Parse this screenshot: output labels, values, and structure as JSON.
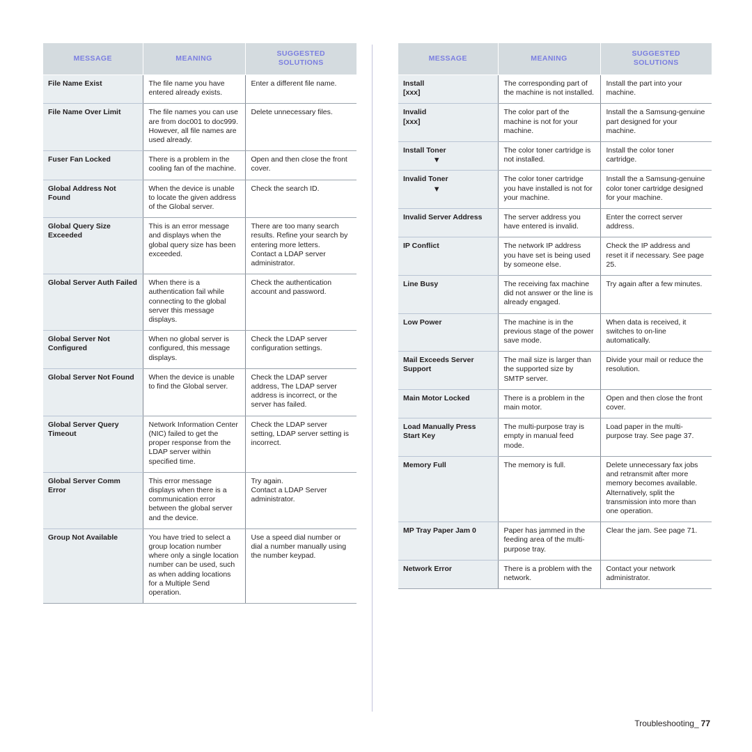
{
  "document": {
    "type": "printer-manual-troubleshooting-page",
    "footer": {
      "section_label": "Troubleshooting_",
      "page_number": "77"
    },
    "colors": {
      "header_background": "#d4dbdf",
      "header_text": "#7b7fe0",
      "message_cell_background": "#e9eef1",
      "body_text": "#231f20"
    }
  },
  "tables": [
    {
      "id": "left-table",
      "headers": [
        "MESSAGE",
        "MEANING",
        "SUGGESTED SOLUTIONS"
      ],
      "header_lines": [
        [
          "MESSAGE"
        ],
        [
          "MEANING"
        ],
        [
          "SUGGESTED",
          "SOLUTIONS"
        ]
      ],
      "rows": [
        {
          "message": "File Name Exist",
          "meaning": "The file name you have entered already exists.",
          "solution": "Enter a different file name."
        },
        {
          "message": "File Name Over Limit",
          "meaning": "The file names you can use are from doc001 to doc999. However, all file names are used already.",
          "solution": "Delete unnecessary files."
        },
        {
          "message": "Fuser Fan Locked",
          "meaning": "There is a problem in the cooling fan of the machine.",
          "solution": "Open and then close the front cover."
        },
        {
          "message": "Global Address Not Found",
          "meaning": "When the device is unable to locate the given address of the Global server.",
          "solution": "Check the search ID."
        },
        {
          "message": "Global Query Size Exceeded",
          "meaning": "This is an error message and displays when the global query size has been exceeded.",
          "solution": "There are too many search results. Refine your search by entering more letters.\nContact a LDAP server administrator."
        },
        {
          "message": "Global Server Auth Failed",
          "meaning": "When there is a authentication fail while connecting to the global server this message displays.",
          "solution": "Check the authentication account and password."
        },
        {
          "message": "Global Server Not Configured",
          "meaning": "When no global server is configured, this message displays.",
          "solution": "Check the LDAP server configuration settings."
        },
        {
          "message": "Global Server Not Found",
          "meaning": "When the device is unable to find the Global server.",
          "solution": "Check the LDAP server address, The LDAP server address is incorrect, or the server has failed."
        },
        {
          "message": "Global Server Query Timeout",
          "meaning": "Network Information Center (NIC) failed to get the proper response from the LDAP server within specified time.",
          "solution": "Check the LDAP server setting, LDAP server setting is incorrect."
        },
        {
          "message": "Global Server Comm Error",
          "meaning": "This error message displays when there is a communication error between the global server and the device.",
          "solution": "Try again.\nContact a LDAP Server administrator."
        },
        {
          "message": "Group Not Available",
          "meaning": "You have tried to select a group location number where only a single location number can be used, such as when adding locations for a Multiple Send operation.",
          "solution": "Use a speed dial number or dial a number manually using the number keypad."
        }
      ]
    },
    {
      "id": "right-table",
      "headers": [
        "MESSAGE",
        "MEANING",
        "SUGGESTED SOLUTIONS"
      ],
      "header_lines": [
        [
          "MESSAGE"
        ],
        [
          "MEANING"
        ],
        [
          "SUGGESTED",
          "SOLUTIONS"
        ]
      ],
      "rows": [
        {
          "message": "Install\n[xxx]",
          "meaning": "The corresponding part of the machine is not installed.",
          "solution": "Install the part into your machine."
        },
        {
          "message": "Invalid\n[xxx]",
          "meaning": "The color part of the machine is not for your machine.",
          "solution": "Install the a Samsung-genuine part designed for your machine."
        },
        {
          "message": "Install Toner",
          "message_glyph": "▼",
          "meaning": "The color toner cartridge is not installed.",
          "solution": "Install the color toner cartridge."
        },
        {
          "message": "Invalid Toner",
          "message_glyph": "▼",
          "meaning": "The color toner cartridge you have installed is not for your machine.",
          "solution": "Install the a Samsung-genuine color toner cartridge designed for your machine."
        },
        {
          "message": "Invalid Server Address",
          "meaning": "The server address you have entered is invalid.",
          "solution": "Enter the correct server address."
        },
        {
          "message": "IP Conflict",
          "meaning": "The network IP address you have set is being used by someone else.",
          "solution": "Check the IP address and reset it if necessary. See page 25."
        },
        {
          "message": "Line Busy",
          "meaning": "The receiving fax machine did not answer or the line is already engaged.",
          "solution": "Try again after a few minutes."
        },
        {
          "message": "Low Power",
          "meaning": "The machine is in the previous stage of the power save mode.",
          "solution": "When data is received, it switches to on-line automatically."
        },
        {
          "message": "Mail Exceeds Server Support",
          "meaning": "The mail size is larger than the supported size by SMTP server.",
          "solution": "Divide your mail or reduce the resolution."
        },
        {
          "message": "Main Motor Locked",
          "meaning": "There is a problem in the main motor.",
          "solution": "Open and then close the front cover."
        },
        {
          "message": "Load Manually Press Start Key",
          "meaning": "The multi-purpose tray is empty in manual feed mode.",
          "solution": "Load paper in the multi-purpose tray. See page 37."
        },
        {
          "message": "Memory Full",
          "meaning": "The memory is full.",
          "solution": "Delete unnecessary fax jobs and retransmit after more memory becomes available. Alternatively, split the transmission into more than one operation."
        },
        {
          "message": "MP Tray Paper Jam 0",
          "meaning": "Paper has jammed in the feeding area of the multi-purpose tray.",
          "solution": "Clear the jam. See page 71."
        },
        {
          "message": "Network Error",
          "meaning": "There is a problem with the network.",
          "solution": "Contact your network administrator."
        }
      ]
    }
  ]
}
